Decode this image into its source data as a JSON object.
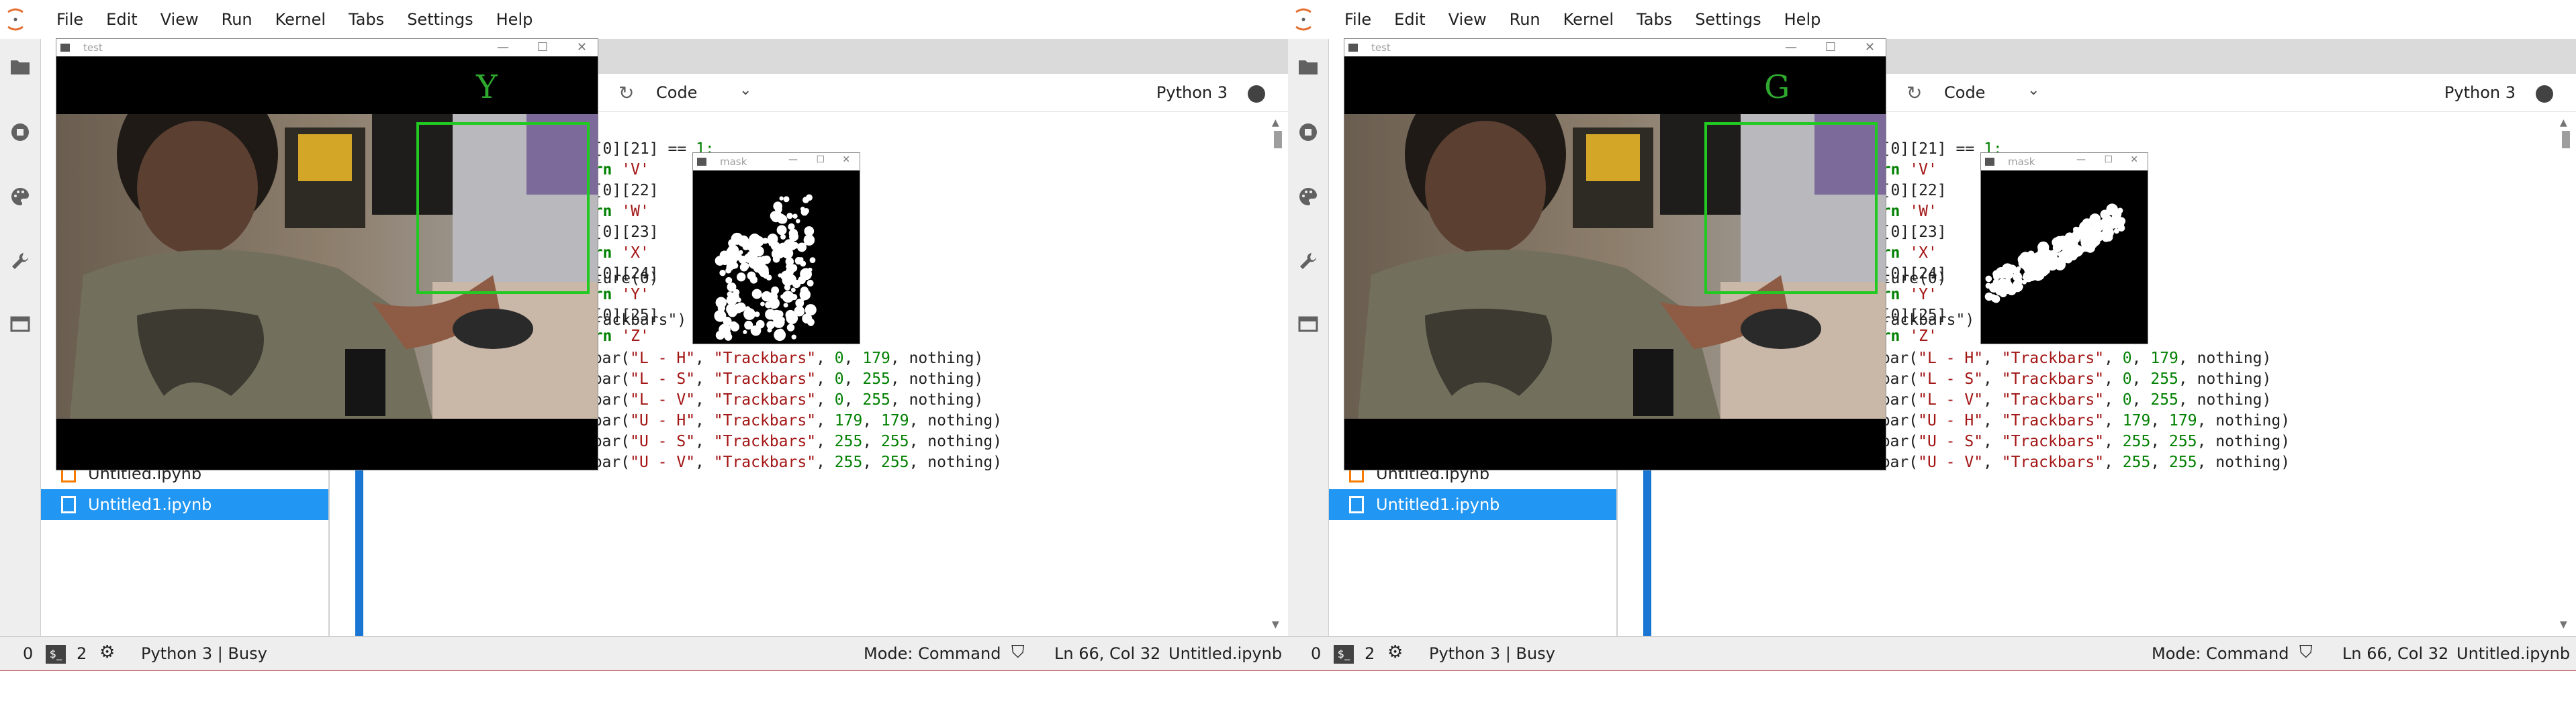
{
  "menu": [
    "File",
    "Edit",
    "View",
    "Run",
    "Kernel",
    "Tabs",
    "Settings",
    "Help"
  ],
  "files": [
    {
      "name": "Untitled.ipynb",
      "active": false
    },
    {
      "name": "Untitled1.ipynb",
      "active": true
    }
  ],
  "toolbar": {
    "cell_type": "Code",
    "kernel": "Python 3"
  },
  "code_top": [
    [
      "lt[0][21] == ",
      "1:"
    ],
    [
      "turn ",
      "'V'"
    ],
    [
      "lt[0][22] ",
      ""
    ],
    [
      "turn ",
      "'W'"
    ],
    [
      "lt[0][23] ",
      ""
    ],
    [
      "turn ",
      "'X'"
    ],
    [
      "lt[0][24] ",
      ""
    ],
    [
      "turn ",
      "'Y'"
    ],
    [
      "lt[0][25] ",
      ""
    ],
    [
      "turn ",
      "'Z'"
    ]
  ],
  "code_mid": [
    "apture(0)",
    "\"Trackbars\")"
  ],
  "trackbars": [
    {
      "name": "\"L - H\"",
      "win": "\"Trackbars\"",
      "a": "0",
      "b": "179"
    },
    {
      "name": "\"L - S\"",
      "win": "\"Trackbars\"",
      "a": "0",
      "b": "255"
    },
    {
      "name": "\"L - V\"",
      "win": "\"Trackbars\"",
      "a": "0",
      "b": "255"
    },
    {
      "name": "\"U - H\"",
      "win": "\"Trackbars\"",
      "a": "179",
      "b": "179"
    },
    {
      "name": "\"U - S\"",
      "win": "\"Trackbars\"",
      "a": "255",
      "b": "255"
    },
    {
      "name": "\"U - V\"",
      "win": "\"Trackbars\"",
      "a": "255",
      "b": "255"
    }
  ],
  "status": {
    "count": "0",
    "terminals": "2",
    "kernel_state": "Python 3 | Busy",
    "mode": "Mode: Command",
    "position": "Ln 66, Col 32",
    "filename": "Untitled.ipynb"
  },
  "windows": {
    "test_title": "test",
    "mask_title": "mask"
  },
  "left": {
    "prediction": "Y"
  },
  "right": {
    "prediction": "G"
  }
}
